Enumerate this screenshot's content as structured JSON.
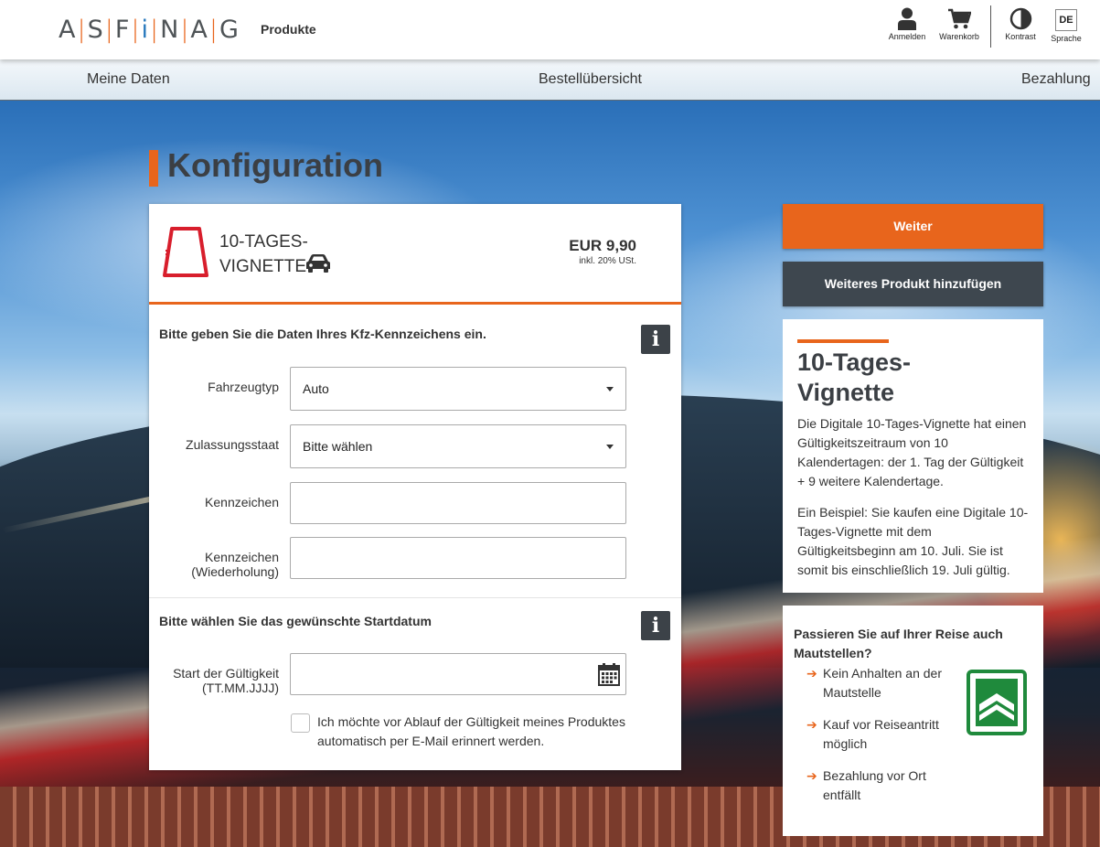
{
  "header": {
    "logo": {
      "letters": [
        "A",
        "S",
        "F",
        "i",
        "N",
        "A",
        "G"
      ]
    },
    "section_label": "Produkte",
    "actions": {
      "login": "Anmelden",
      "cart": "Warenkorb",
      "contrast": "Kontrast",
      "language_code": "DE",
      "language_label": "Sprache"
    }
  },
  "steps": [
    "Meine Daten",
    "Bestellübersicht",
    "Bezahlung"
  ],
  "page_title": "Konfiguration",
  "product": {
    "name_line1": "10-TAGES-",
    "name_line2": "VIGNETTE",
    "price": "EUR 9,90",
    "price_note": "inkl. 20% USt."
  },
  "vehicle_section": {
    "title": "Bitte geben Sie die Daten Ihres Kfz-Kennzeichens ein.",
    "fields": {
      "vehicle_type_label": "Fahrzeugtyp",
      "vehicle_type_value": "Auto",
      "country_label": "Zulassungsstaat",
      "country_value": "Bitte wählen",
      "plate_label": "Kennzeichen",
      "plate_value": "",
      "plate_repeat_label_1": "Kennzeichen",
      "plate_repeat_label_2": "(Wiederholung)",
      "plate_repeat_value": ""
    }
  },
  "date_section": {
    "title": "Bitte wählen Sie das gewünschte Startdatum",
    "start_label_1": "Start der Gültigkeit",
    "start_label_2": "(TT.MM.JJJJ)",
    "start_value": "",
    "reminder_checked": false,
    "reminder_label": "Ich möchte vor Ablauf der Gültigkeit meines Produktes automatisch per E-Mail erinnert werden."
  },
  "sidebar": {
    "continue_button": "Weiter",
    "add_product_button": "Weiteres Produkt hinzufügen",
    "info": {
      "title_line1": "10-Tages-",
      "title_line2": "Vignette",
      "paragraph1": "Die Digitale 10-Tages-Vignette hat einen Gültigkeitszeitraum von 10 Kalendertagen: der 1. Tag der Gültigkeit + 9 weitere Kalendertage.",
      "paragraph2": "Ein Beispiel: Sie kaufen eine Digitale 10-Tages-Vignette mit dem Gültigkeitsbeginn am 10. Juli. Sie ist somit bis einschließlich 19. Juli gültig."
    },
    "toll": {
      "title": "Passieren Sie auf Ihrer Reise auch Mautstellen?",
      "bullets": [
        "Kein Anhalten an der Mautstelle",
        "Kauf vor Reiseantritt möglich",
        "Bezahlung vor Ort entfällt"
      ]
    }
  },
  "colors": {
    "accent": "#e8651c",
    "dark_button": "#3e474f",
    "info_button": "#3c4248",
    "vignette_red": "#d81e2c",
    "go_green": "#1f8a3c"
  },
  "icons": [
    "user-icon",
    "cart-icon",
    "contrast-icon",
    "vignette-icon",
    "car-icon",
    "info-icon",
    "calendar-icon",
    "arrow-right-icon",
    "go-box-icon"
  ]
}
